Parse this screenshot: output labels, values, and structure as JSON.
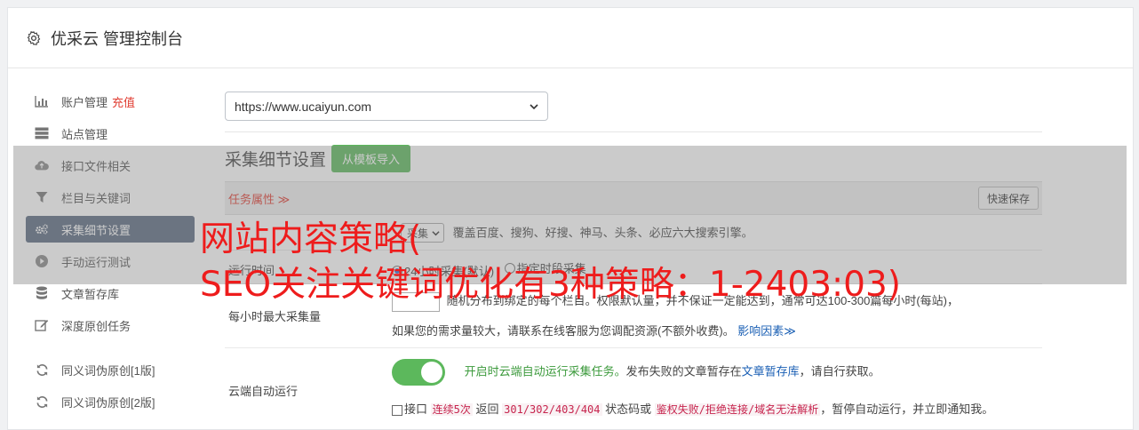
{
  "app": {
    "title": "优采云 管理控制台"
  },
  "sidebar": {
    "items": [
      {
        "label": "账户管理",
        "badge": "充值",
        "icon": "bar-chart-icon"
      },
      {
        "label": "站点管理",
        "icon": "server-icon"
      },
      {
        "label": "接口文件相关",
        "icon": "cloud-upload-icon"
      },
      {
        "label": "栏目与关键词",
        "icon": "filter-icon"
      },
      {
        "label": "采集细节设置",
        "icon": "cogs-icon",
        "active": true
      },
      {
        "label": "手动运行测试",
        "icon": "play-circle-icon"
      },
      {
        "label": "文章暂存库",
        "icon": "database-icon"
      },
      {
        "label": "深度原创任务",
        "icon": "edit-icon"
      }
    ],
    "extra_items": [
      {
        "label": "同义词伪原创[1版]",
        "icon": "refresh-icon"
      },
      {
        "label": "同义词伪原创[2版]",
        "icon": "refresh-icon"
      }
    ]
  },
  "main": {
    "site_select": {
      "value": "https://www.ucaiyun.com"
    },
    "section_title": "采集细节设置",
    "import_button": "从模板导入",
    "strip": {
      "task_attr": "任务属性 ≫",
      "quick_save": "快速保存"
    },
    "rows": {
      "engine": {
        "label": "",
        "select": "采集",
        "desc": "覆盖百度、搜狗、好搜、神马、头条、必应六大搜索引擎。"
      },
      "runtime": {
        "label": "运行时间",
        "opt1": "24小时采集(默认)",
        "opt2": "指定时段采集"
      },
      "max": {
        "label": "每小时最大采集量",
        "line1": "随机分布到绑定的每个栏目。权限默认量，并不保证一定能达到，通常可达100-300篇每小时(每站)，",
        "line2": "如果您的需求量较大，请联系在线客服为您调配资源(不额外收费)。",
        "link": "影响因素≫"
      },
      "cloud": {
        "label": "云端自动运行",
        "text_green": "开启时云端自动运行采集任务。",
        "text1": "发布失败的文章暂存在",
        "link": "文章暂存库",
        "text2": "，请自行获取。",
        "chk_label": "接口",
        "code1": "连续5次",
        "t_return": "返回",
        "code2": "301/302/403/404",
        "t_status": "状态码或",
        "code3": "鉴权失败/拒绝连接/域名无法解析",
        "t_end": "，暂停自动运行，并立即通知我。"
      }
    }
  },
  "overlay": {
    "line1": "网站内容策略(",
    "line2": "SEO关注关键词优化有3种策略：1-2403:03)"
  },
  "colors": {
    "accent_green": "#5cb85c",
    "active_nav": "#5b6a80",
    "danger": "#e03c31",
    "link": "#1a5fb4"
  }
}
